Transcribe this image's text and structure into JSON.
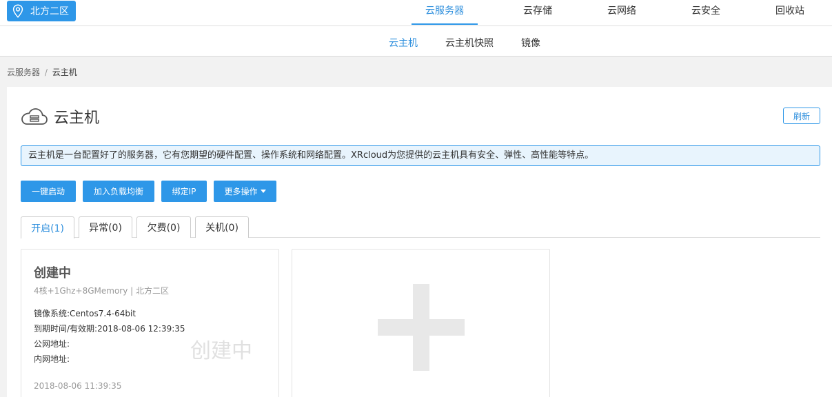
{
  "region": {
    "label": "北方二区",
    "icon": "location-pin-icon"
  },
  "main_nav": [
    {
      "label": "云服务器",
      "active": true
    },
    {
      "label": "云存储",
      "active": false
    },
    {
      "label": "云网络",
      "active": false
    },
    {
      "label": "云安全",
      "active": false
    },
    {
      "label": "回收站",
      "active": false
    }
  ],
  "sub_nav": [
    {
      "label": "云主机",
      "active": true
    },
    {
      "label": "云主机快照",
      "active": false
    },
    {
      "label": "镜像",
      "active": false
    }
  ],
  "breadcrumb": {
    "parent": "云服务器",
    "separator": "/",
    "current": "云主机"
  },
  "page": {
    "title": "云主机",
    "icon": "cloud-server-icon",
    "refresh_label": "刷新",
    "notice": "云主机是一台配置好了的服务器，它有您期望的硬件配置、操作系统和网络配置。XRcloud为您提供的云主机具有安全、弹性、高性能等特点。"
  },
  "actions": [
    {
      "label": "一键启动"
    },
    {
      "label": "加入负载均衡"
    },
    {
      "label": "绑定IP"
    },
    {
      "label": "更多操作"
    }
  ],
  "state_tabs": [
    {
      "label": "开启(1)",
      "active": true
    },
    {
      "label": "异常(0)",
      "active": false
    },
    {
      "label": "欠费(0)",
      "active": false
    },
    {
      "label": "关机(0)",
      "active": false
    }
  ],
  "instance_card": {
    "title": "创建中",
    "spec": "4核+1Ghz+8GMemory | 北方二区",
    "image": "镜像系统:Centos7.4-64bit",
    "expiry": "到期时间/有效期:2018-08-06 12:39:35",
    "public_ip": "公网地址:",
    "private_ip": "内网地址:",
    "watermark": "创建中",
    "created": "2018-08-06 11:39:35"
  },
  "add_card": {
    "icon": "plus-icon"
  },
  "colors": {
    "accent": "#2e97e8",
    "accent_text": "#2e8fdd",
    "notice_bg": "#e8f4fd",
    "page_bg": "#f2f2f2"
  }
}
